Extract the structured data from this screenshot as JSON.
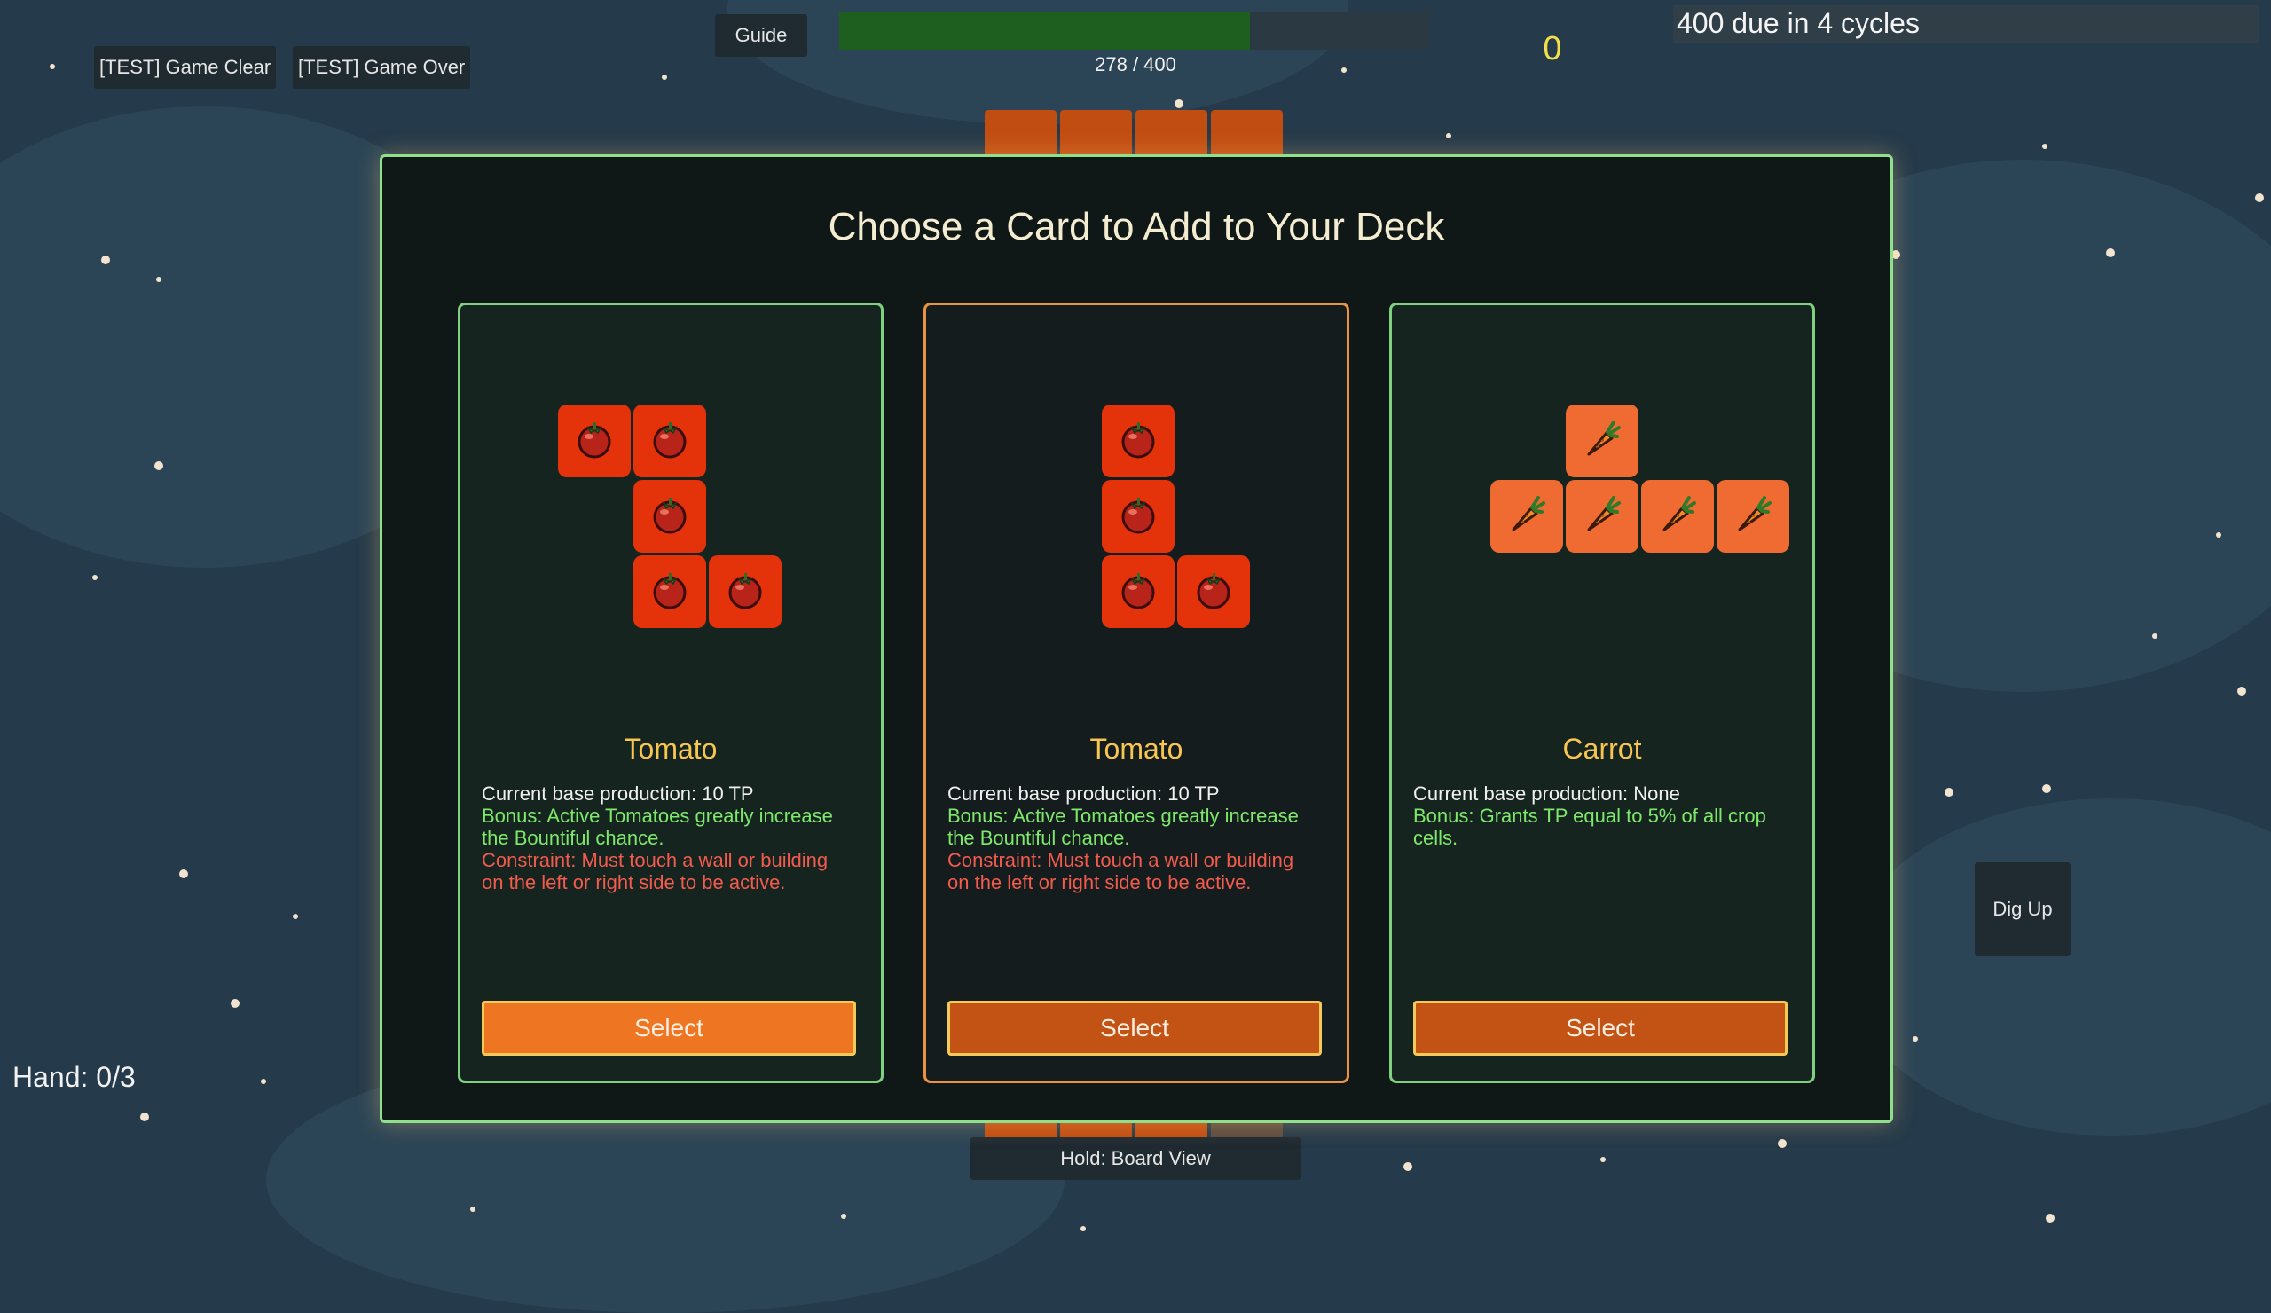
{
  "test_buttons": {
    "game_clear": "[TEST] Game Clear",
    "game_over": "[TEST] Game Over"
  },
  "guide_label": "Guide",
  "progress": {
    "current": 278,
    "total": 400,
    "text": "278 / 400",
    "fraction": 0.695
  },
  "score": "0",
  "due_text": "400 due in 4 cycles",
  "hand_text": "Hand: 0/3",
  "dig_up_label": "Dig Up",
  "hold_label": "Hold: Board View",
  "modal": {
    "title": "Choose a Card to Add to Your Deck",
    "cards": [
      {
        "name": "Tomato",
        "base": "Current base production: 10 TP",
        "bonus": "Bonus: Active Tomatoes greatly increase the Bountiful chance.",
        "constraint": "Constraint: Must touch a wall or building on the left or right side to be active.",
        "select": "Select",
        "crop_icon": "tomato-icon"
      },
      {
        "name": "Tomato",
        "base": "Current base production: 10 TP",
        "bonus": "Bonus: Active Tomatoes greatly increase the Bountiful chance.",
        "constraint": "Constraint: Must touch a wall or building on the left or right side to be active.",
        "select": "Select",
        "crop_icon": "tomato-icon"
      },
      {
        "name": "Carrot",
        "base": "Current base production: None",
        "bonus": "Bonus: Grants TP equal to 5% of all crop cells.",
        "constraint": "",
        "select": "Select",
        "crop_icon": "carrot-icon"
      }
    ]
  },
  "colors": {
    "background": "#253a4a",
    "modal_border": "#8fe08a",
    "card_name": "#f7c552",
    "bonus_text": "#7ee86a",
    "constraint_text": "#f25b4d",
    "score": "#f2df4a",
    "progress_fill": "#1e5e1e",
    "tomato_cell": "#e4330b",
    "carrot_cell": "#f06b31",
    "select_button": "#c35315"
  }
}
